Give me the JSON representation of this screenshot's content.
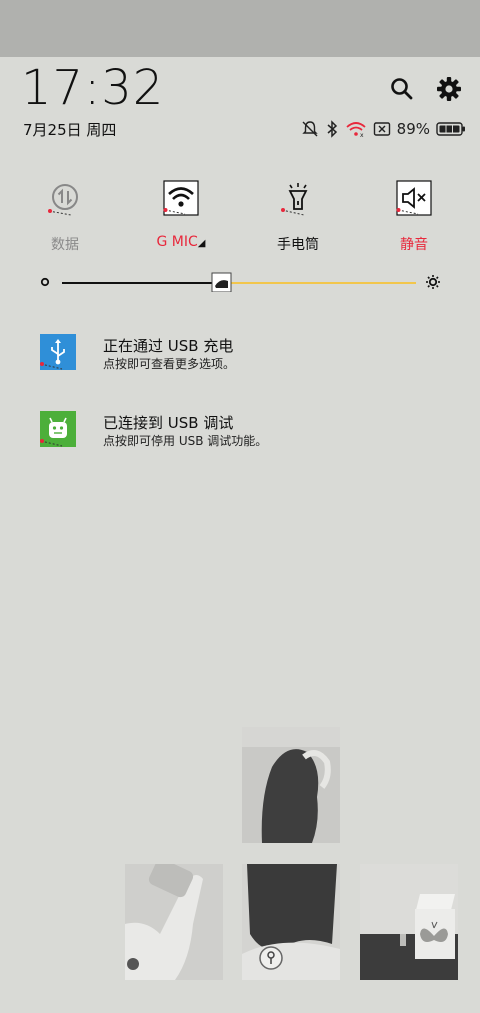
{
  "header": {
    "time": "17:32",
    "date": "7月25日 周四"
  },
  "status_bar": {
    "battery_percent": "89%",
    "battery_level": 0.89
  },
  "quick_tiles": [
    {
      "label": "数据",
      "icon": "data-toggle-icon",
      "state": "off"
    },
    {
      "label": "G MIC",
      "icon": "wifi-icon",
      "state": "on"
    },
    {
      "label": "手电筒",
      "icon": "flashlight-icon",
      "state": "off"
    },
    {
      "label": "静音",
      "icon": "mute-icon",
      "state": "on"
    }
  ],
  "brightness": {
    "level": 0.42
  },
  "notifications": [
    {
      "title": "正在通过 USB 充电",
      "subtitle": "点按即可查看更多选项。",
      "icon": "usb-icon",
      "color": "#2f8fd8"
    },
    {
      "title": "已连接到 USB 调试",
      "subtitle": "点按即可停用 USB 调试功能。",
      "icon": "android-debug-icon",
      "color": "#4caf3a"
    }
  ],
  "colors": {
    "accent": "#e8283c",
    "slider_active": "#f2c64c",
    "background": "#d9dad6"
  }
}
